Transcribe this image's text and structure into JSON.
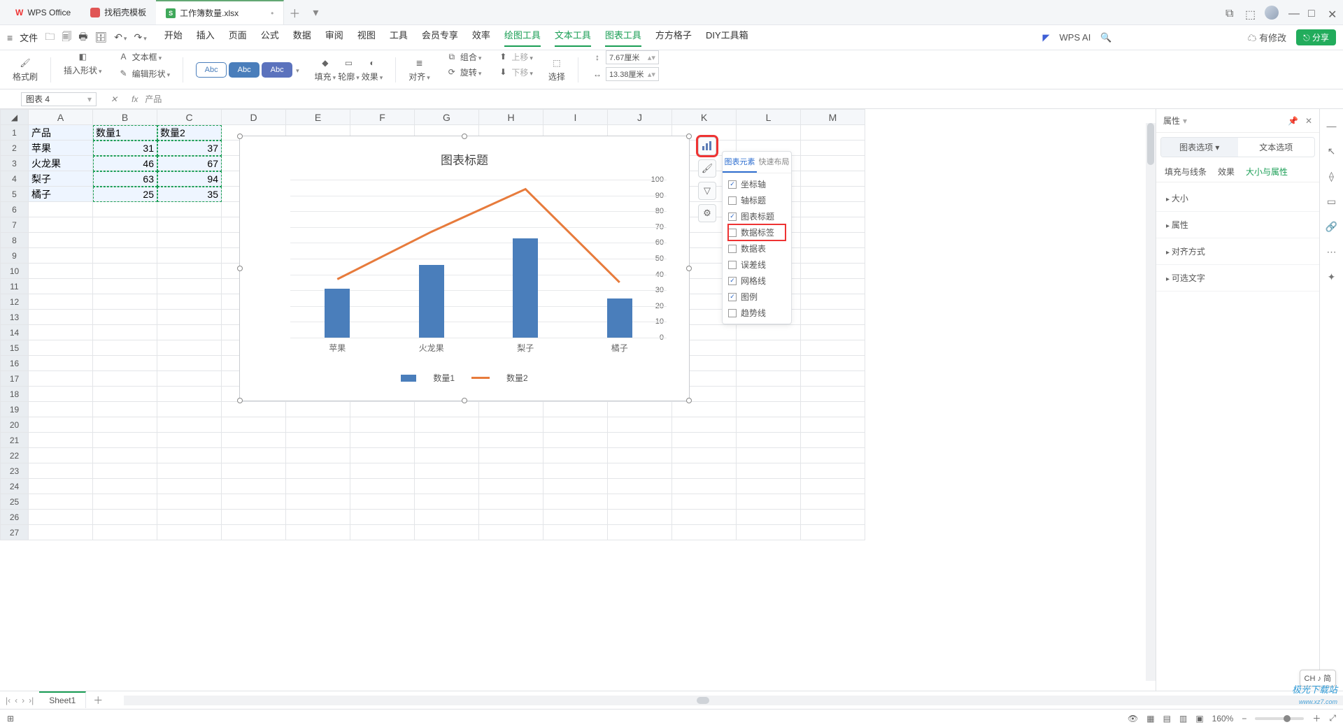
{
  "titlebar": {
    "app": "WPS Office",
    "tab2": "找稻壳模板",
    "active_tab": "工作簿数量.xlsx"
  },
  "menubar": {
    "file": "文件",
    "items": [
      "开始",
      "插入",
      "页面",
      "公式",
      "数据",
      "审阅",
      "视图",
      "工具",
      "会员专享",
      "效率",
      "绘图工具",
      "文本工具",
      "图表工具",
      "方方格子",
      "DIY工具箱"
    ],
    "right_ai": "WPS AI",
    "right_mod": "有修改",
    "right_share": "分享"
  },
  "ribbon": {
    "format_painter": "格式刷",
    "insert_shape": "插入形状",
    "textbox": "文本框",
    "edit_shape": "编辑形状",
    "abc": "Abc",
    "fill": "填充",
    "outline": "轮廓",
    "effect": "效果",
    "align": "对齐",
    "group": "组合",
    "rotate": "旋转",
    "up": "上移",
    "down": "下移",
    "select": "选择",
    "width": "7.67厘米",
    "height": "13.38厘米"
  },
  "namebox": "图表 4",
  "fx_content": "产品",
  "sheet": {
    "cols": [
      "A",
      "B",
      "C",
      "D",
      "E",
      "F",
      "G",
      "H",
      "I",
      "J",
      "K",
      "L",
      "M"
    ],
    "rows": 27,
    "r1": {
      "a": "产品",
      "b": "数量1",
      "c": "数量2"
    },
    "r2": {
      "a": "苹果",
      "b": "31",
      "c": "37"
    },
    "r3": {
      "a": "火龙果",
      "b": "46",
      "c": "67"
    },
    "r4": {
      "a": "梨子",
      "b": "63",
      "c": "94"
    },
    "r5": {
      "a": "橘子",
      "b": "25",
      "c": "35"
    }
  },
  "chart_data": {
    "type": "combo",
    "title": "图表标题",
    "categories": [
      "苹果",
      "火龙果",
      "梨子",
      "橘子"
    ],
    "series": [
      {
        "name": "数量1",
        "type": "bar",
        "values": [
          31,
          46,
          63,
          25
        ]
      },
      {
        "name": "数量2",
        "type": "line",
        "values": [
          37,
          67,
          94,
          35
        ]
      }
    ],
    "ylim": [
      0,
      100
    ],
    "ytick_step": 10,
    "grid": true,
    "legend_names": {
      "s1": "数量1",
      "s2": "数量2"
    }
  },
  "popover": {
    "tab1": "图表元素",
    "tab2": "快速布局",
    "items": [
      {
        "label": "坐标轴",
        "checked": true
      },
      {
        "label": "轴标题",
        "checked": false
      },
      {
        "label": "图表标题",
        "checked": true
      },
      {
        "label": "数据标签",
        "checked": false,
        "marked": true
      },
      {
        "label": "数据表",
        "checked": false
      },
      {
        "label": "误差线",
        "checked": false
      },
      {
        "label": "网格线",
        "checked": true
      },
      {
        "label": "图例",
        "checked": true
      },
      {
        "label": "趋势线",
        "checked": false
      }
    ]
  },
  "side": {
    "title": "属性",
    "tab_chart": "图表选项",
    "tab_text": "文本选项",
    "sub1": "填充与线条",
    "sub2": "效果",
    "sub3": "大小与属性",
    "sec1": "大小",
    "sec2": "属性",
    "sec3": "对齐方式",
    "sec4": "可选文字"
  },
  "sheet_tab": "Sheet1",
  "status": {
    "zoom": "160%"
  },
  "ime": "CH ♪ 简"
}
